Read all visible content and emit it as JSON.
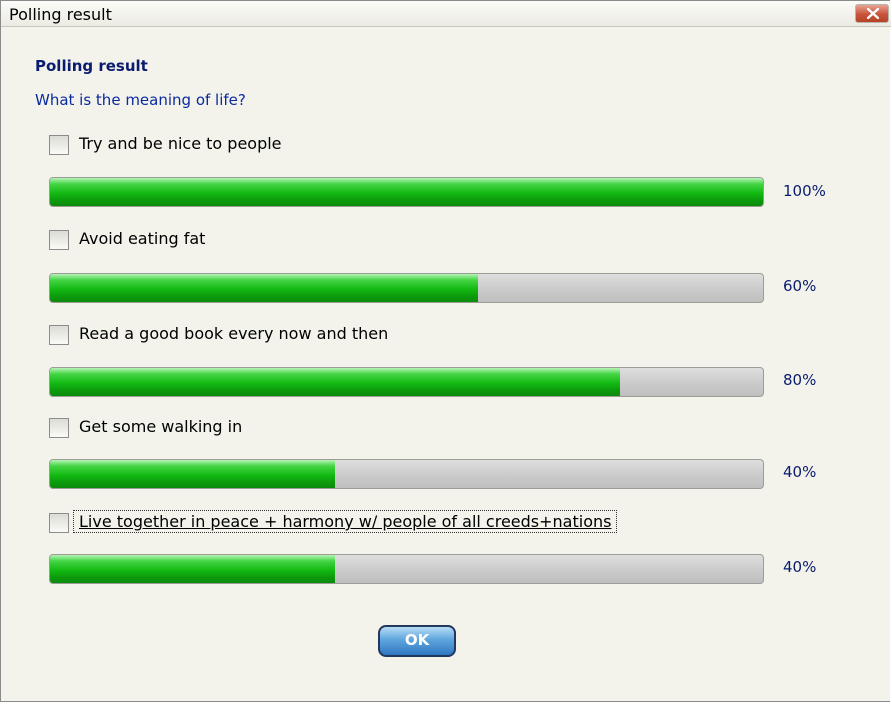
{
  "window": {
    "title": "Polling result",
    "close_icon": "close-icon"
  },
  "poll": {
    "heading": "Polling result",
    "question": "What is the meaning of life?",
    "options": [
      {
        "label": "Try and be nice to people",
        "percent_label": "100%",
        "percent": 100,
        "checked": false
      },
      {
        "label": "Avoid eating fat",
        "percent_label": "60%",
        "percent": 60,
        "checked": false
      },
      {
        "label": "Read a good book every now and then",
        "percent_label": "80%",
        "percent": 80,
        "checked": false
      },
      {
        "label": "Get some walking in",
        "percent_label": "40%",
        "percent": 40,
        "checked": false
      },
      {
        "label": "Live together in peace + harmony w/ people of all creeds+nations",
        "percent_label": "40%",
        "percent": 40,
        "checked": false,
        "focused": true
      }
    ]
  },
  "buttons": {
    "ok_label": "OK"
  },
  "colors": {
    "bar_fill": "#12b912",
    "bar_track": "#c9c9c9",
    "heading": "#0a1c6e",
    "ok_button": "#2f76c2"
  }
}
